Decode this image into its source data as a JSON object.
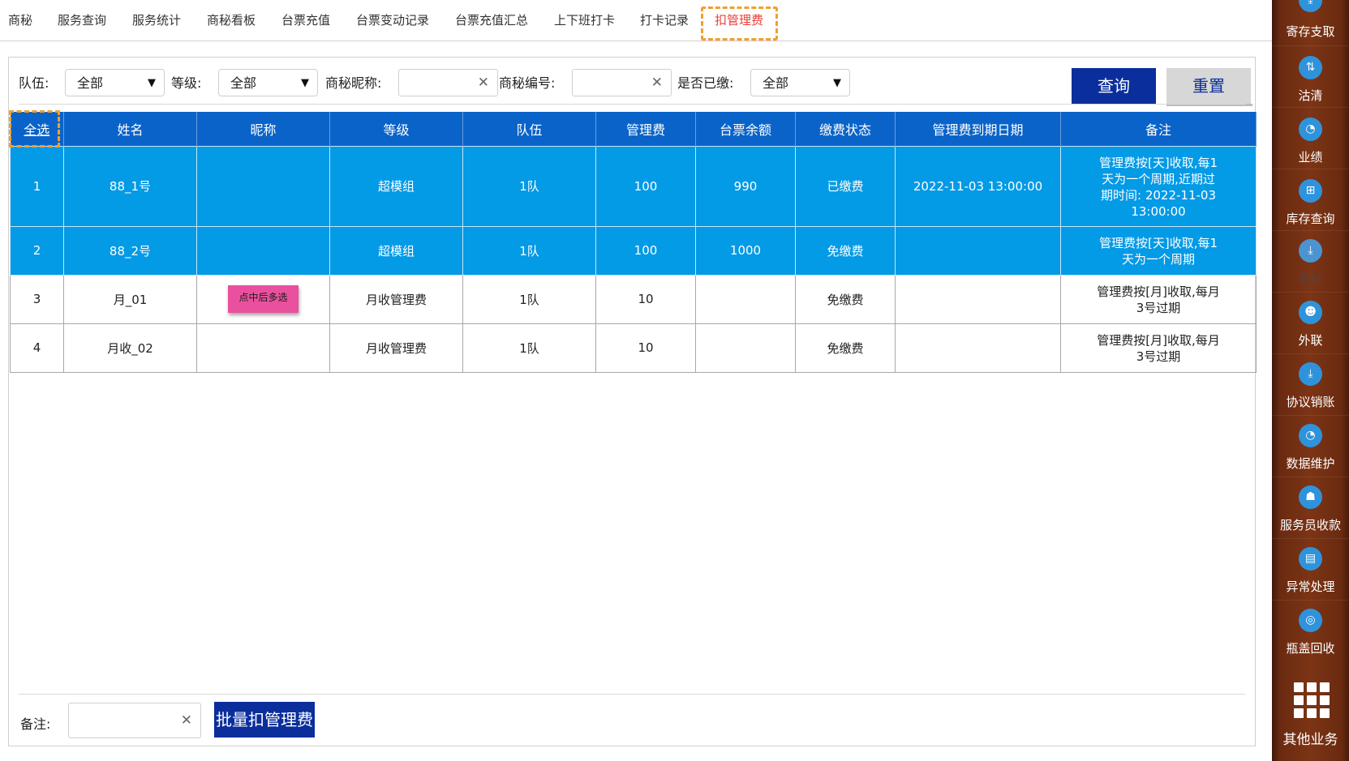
{
  "tabs": [
    {
      "label": "商秘"
    },
    {
      "label": "服务查询"
    },
    {
      "label": "服务统计"
    },
    {
      "label": "商秘看板"
    },
    {
      "label": "台票充值"
    },
    {
      "label": "台票变动记录"
    },
    {
      "label": "台票充值汇总"
    },
    {
      "label": "上下班打卡"
    },
    {
      "label": "打卡记录"
    },
    {
      "label": "扣管理费"
    }
  ],
  "filters": {
    "team_label": "队伍:",
    "team_value": "全部",
    "level_label": "等级:",
    "level_value": "全部",
    "nickname_label": "商秘昵称:",
    "nickname_value": "",
    "number_label": "商秘编号:",
    "number_value": "",
    "paid_label": "是否已缴:",
    "paid_value": "全部",
    "query_label": "查询",
    "reset_label": "重置"
  },
  "table": {
    "headers": [
      "全选",
      "姓名",
      "昵称",
      "等级",
      "队伍",
      "管理费",
      "台票余额",
      "缴费状态",
      "管理费到期日期",
      "备注"
    ],
    "rows": [
      {
        "idx": "1",
        "name": "88_1号",
        "nickname": "",
        "level": "超模组",
        "team": "1队",
        "fee": "100",
        "balance": "990",
        "status": "已缴费",
        "expiry": "2022-11-03 13:00:00",
        "note": [
          "管理费按[天]收取,每1",
          "天为一个周期,近期过",
          "期时间: 2022-11-03",
          "13:00:00"
        ]
      },
      {
        "idx": "2",
        "name": "88_2号",
        "nickname": "",
        "level": "超模组",
        "team": "1队",
        "fee": "100",
        "balance": "1000",
        "status": "免缴费",
        "expiry": "",
        "note": [
          "管理费按[天]收取,每1",
          "天为一个周期"
        ]
      },
      {
        "idx": "3",
        "name": "月_01",
        "nickname": "点中后多选",
        "level": "月收管理费",
        "team": "1队",
        "fee": "10",
        "balance": "",
        "status": "免缴费",
        "expiry": "",
        "note": [
          "管理费按[月]收取,每月",
          "3号过期"
        ]
      },
      {
        "idx": "4",
        "name": "月收_02",
        "nickname": "",
        "level": "月收管理费",
        "team": "1队",
        "fee": "10",
        "balance": "",
        "status": "免缴费",
        "expiry": "",
        "note": [
          "管理费按[月]收取,每月",
          "3号过期"
        ]
      }
    ]
  },
  "bottom": {
    "remark_label": "备注:",
    "remark_value": "",
    "batch_label": "批量扣管理费"
  },
  "sidebar": {
    "items": [
      {
        "label": "寄存支取",
        "icon": "download-icon"
      },
      {
        "label": "沽清",
        "icon": "sort-icon"
      },
      {
        "label": "业绩",
        "icon": "pie-chart-icon"
      },
      {
        "label": "库存查询",
        "icon": "grid-search-icon"
      },
      {
        "label": "商秘",
        "icon": "download-icon"
      },
      {
        "label": "外联",
        "icon": "person-icon"
      },
      {
        "label": "协议销账",
        "icon": "download-icon"
      },
      {
        "label": "数据维护",
        "icon": "pie-chart-icon"
      },
      {
        "label": "服务员收款",
        "icon": "user-card-icon"
      },
      {
        "label": "异常处理",
        "icon": "calendar-icon"
      },
      {
        "label": "瓶盖回收",
        "icon": "bottle-icon"
      }
    ],
    "more_label": "其他业务"
  },
  "colors": {
    "header_blue": "#0a63c9",
    "selected_row": "#039ae6",
    "button_navy": "#0a2e9c",
    "active_tab": "#e8403a",
    "highlight_dash": "#f0a030",
    "sticky_note": "#e9519e",
    "sidebar_wood": "#7c3415"
  }
}
